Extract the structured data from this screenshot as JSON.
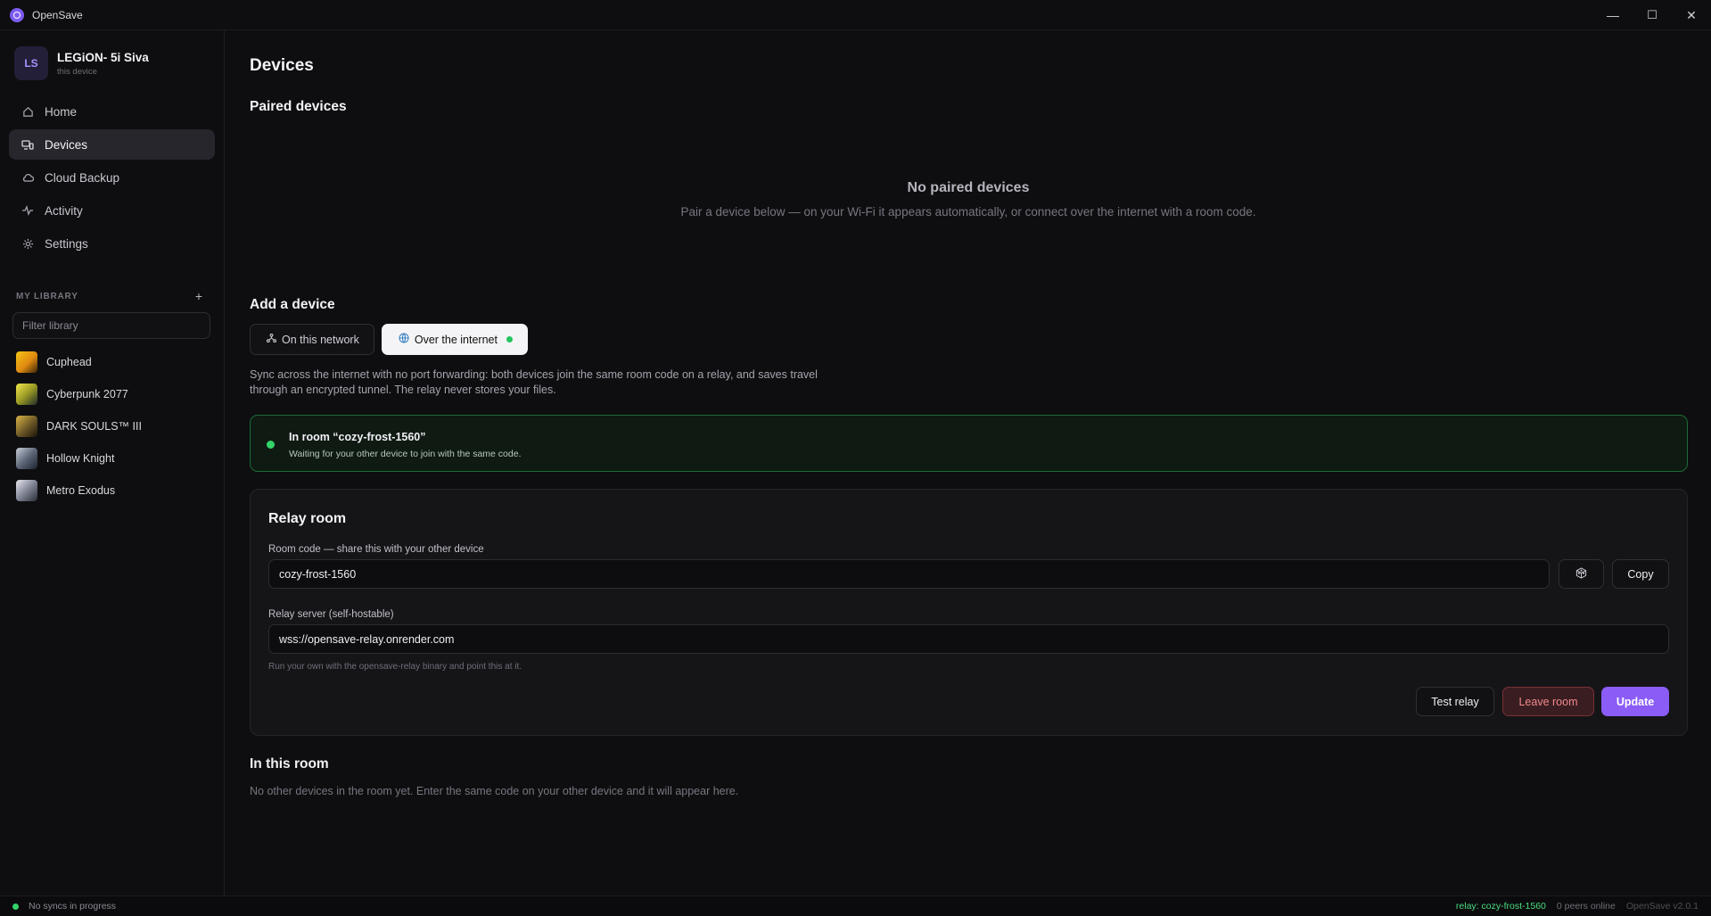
{
  "window": {
    "title": "OpenSave",
    "minimize": "—",
    "maximize": "☐",
    "close": "✕"
  },
  "device": {
    "initials": "LS",
    "name": "LEGiON- 5i Siva",
    "sub": "this device"
  },
  "nav": {
    "items": [
      {
        "label": "Home",
        "icon": "home-icon"
      },
      {
        "label": "Devices",
        "icon": "devices-icon"
      },
      {
        "label": "Cloud Backup",
        "icon": "cloud-icon"
      },
      {
        "label": "Activity",
        "icon": "activity-icon"
      },
      {
        "label": "Settings",
        "icon": "gear-icon"
      }
    ]
  },
  "library": {
    "title": "MY LIBRARY",
    "add": "+",
    "filter_placeholder": "Filter library",
    "games": [
      {
        "name": "Cuphead"
      },
      {
        "name": "Cyberpunk 2077"
      },
      {
        "name": "DARK SOULS™ III"
      },
      {
        "name": "Hollow Knight"
      },
      {
        "name": "Metro Exodus"
      }
    ]
  },
  "main": {
    "title": "Devices",
    "paired": {
      "heading": "Paired devices",
      "empty_title": "No paired devices",
      "empty_sub": "Pair a device below — on your Wi-Fi it appears automatically, or connect over the internet with a room code."
    },
    "add": {
      "heading": "Add a device",
      "tab_network": "On this network",
      "tab_internet": "Over the internet",
      "intro": "Sync across the internet with no port forwarding: both devices join the same room code on a relay, and saves travel through an encrypted tunnel. The relay never stores your files."
    },
    "status": {
      "title": "In room “cozy-frost-1560”",
      "sub": "Waiting for your other device to join with the same code."
    },
    "relay": {
      "heading": "Relay room",
      "code_label": "Room code — share this with your other device",
      "code_value": "cozy-frost-1560",
      "copy": "Copy",
      "server_label": "Relay server (self-hostable)",
      "server_value": "wss://opensave-relay.onrender.com",
      "hint": "Run your own with the opensave-relay binary and point this at it.",
      "test": "Test relay",
      "leave": "Leave room",
      "update": "Update"
    },
    "room": {
      "heading": "In this room",
      "empty": "No other devices in the room yet. Enter the same code on your other device and it will appear here."
    }
  },
  "statusbar": {
    "left": "No syncs in progress",
    "relay": "relay: cozy-frost-1560",
    "peers": "0 peers online",
    "version": "OpenSave v2.0.1"
  }
}
